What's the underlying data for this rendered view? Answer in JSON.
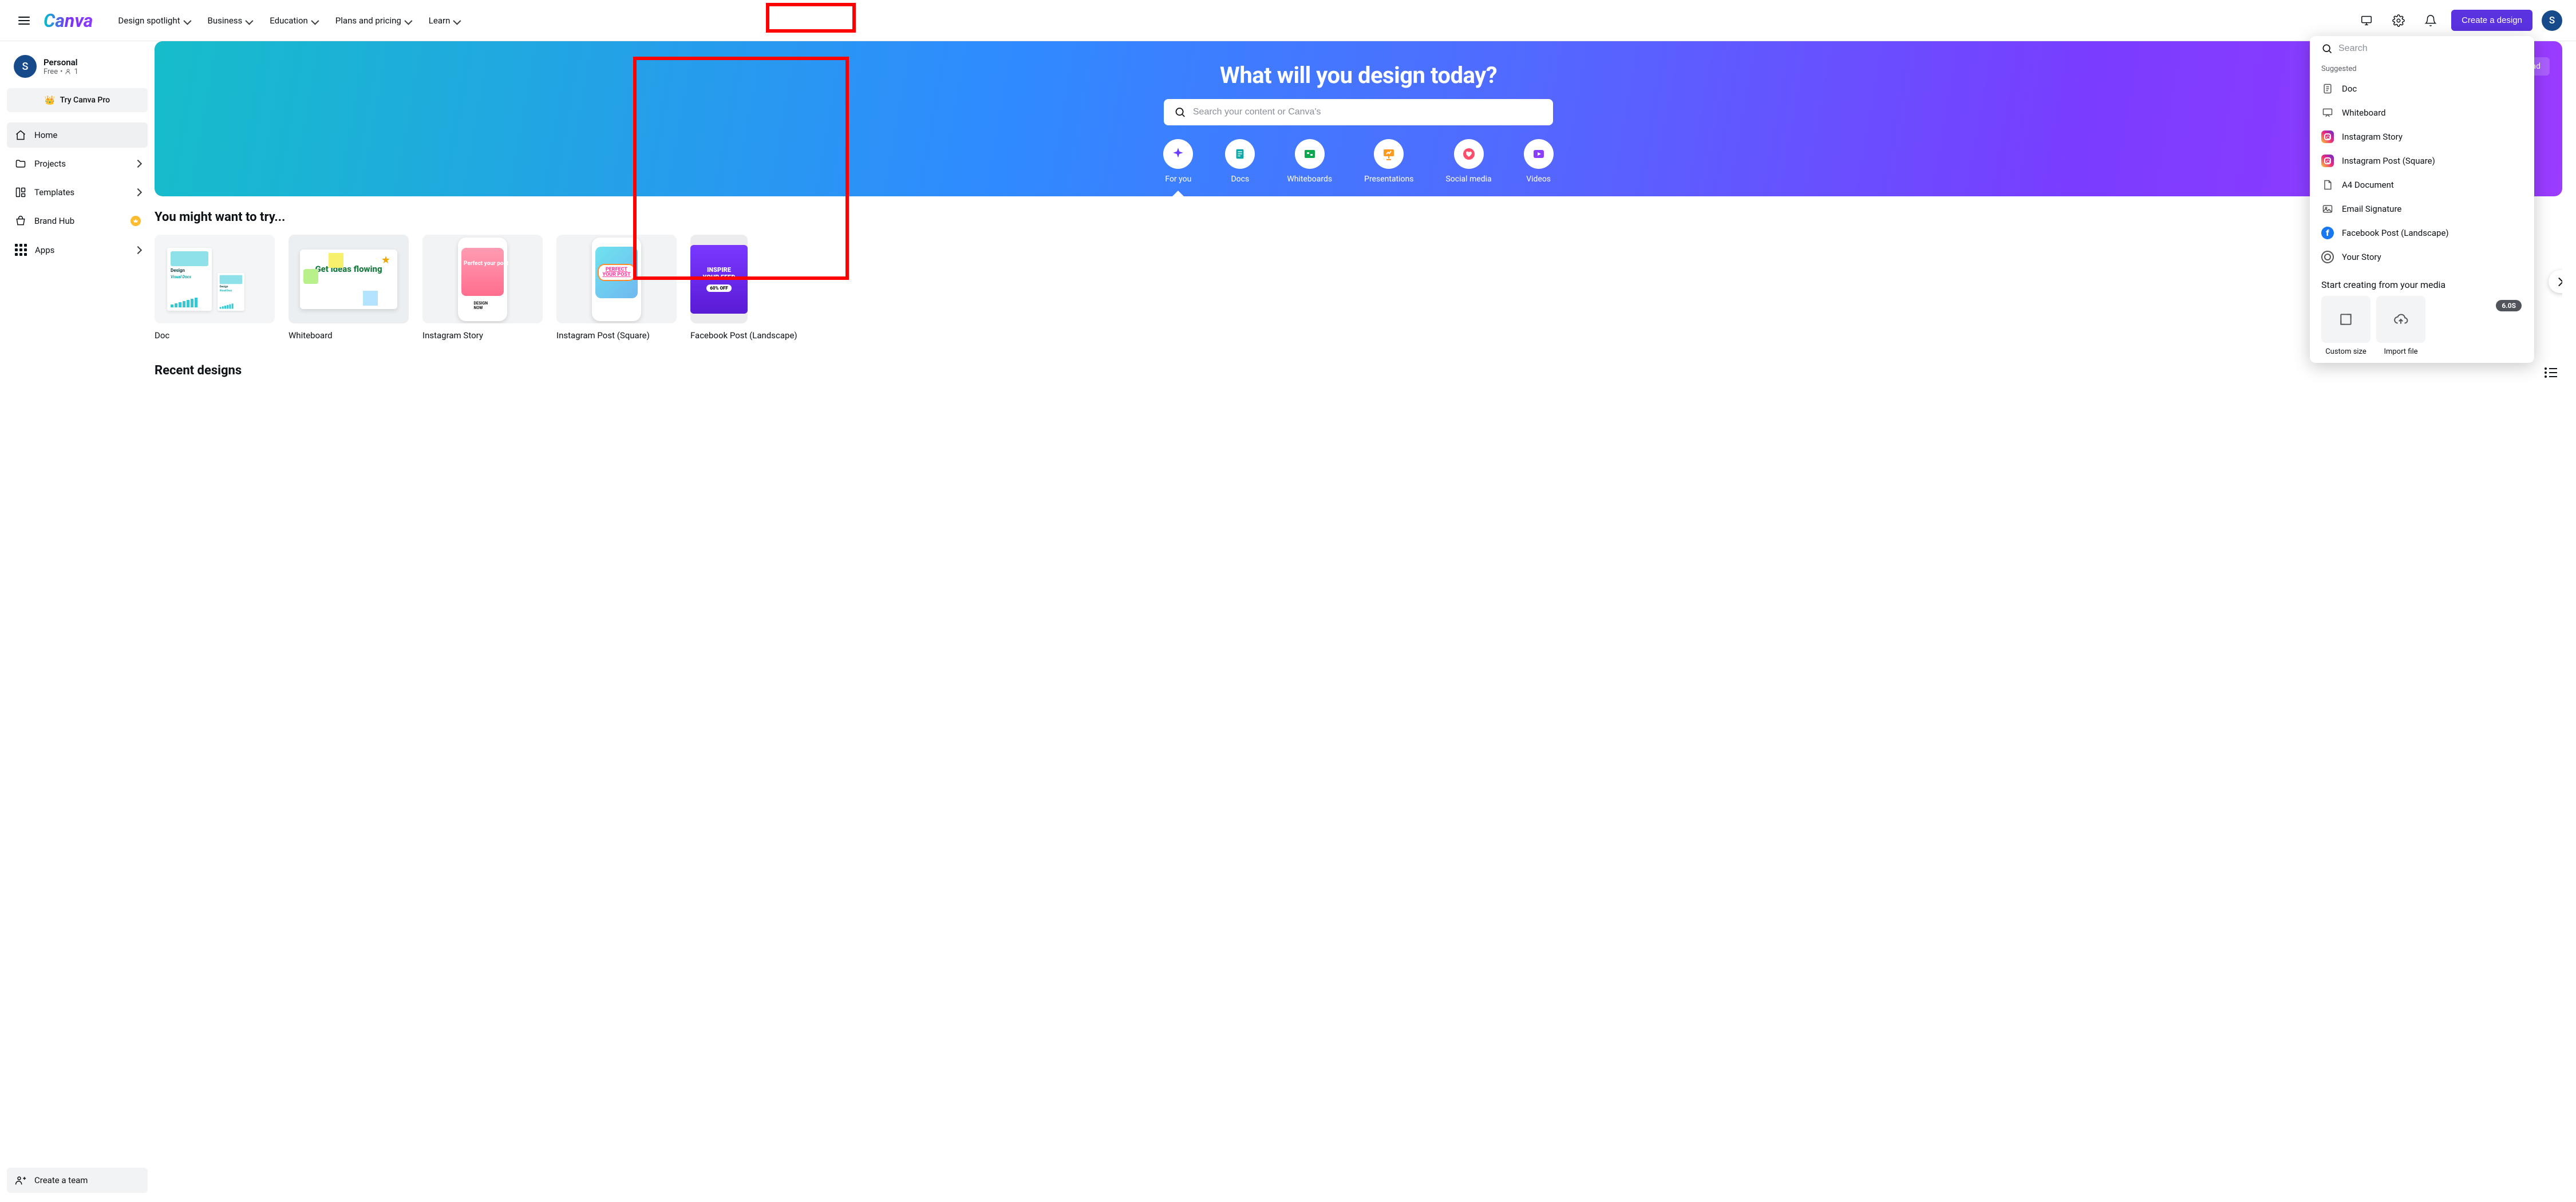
{
  "nav": {
    "links": [
      "Design spotlight",
      "Business",
      "Education",
      "Plans and pricing",
      "Learn"
    ],
    "create_label": "Create a design",
    "avatar_initial": "S"
  },
  "sidebar": {
    "user": {
      "initial": "S",
      "name": "Personal",
      "plan": "Free",
      "members": "1"
    },
    "try_pro": "Try Canva Pro",
    "items": [
      {
        "key": "home",
        "label": "Home",
        "active": true,
        "chev": false
      },
      {
        "key": "projects",
        "label": "Projects",
        "chev": true
      },
      {
        "key": "templates",
        "label": "Templates",
        "chev": true
      },
      {
        "key": "brand-hub",
        "label": "Brand Hub",
        "badge": true
      },
      {
        "key": "apps",
        "label": "Apps",
        "chev": true
      }
    ],
    "create_team": "Create a team"
  },
  "hero": {
    "title": "What will you design today?",
    "upload": "Upload",
    "search_placeholder": "Search your content or Canva's",
    "tabs": [
      {
        "key": "for-you",
        "label": "For you"
      },
      {
        "key": "docs",
        "label": "Docs"
      },
      {
        "key": "whiteboards",
        "label": "Whiteboards"
      },
      {
        "key": "presentations",
        "label": "Presentations"
      },
      {
        "key": "social-media",
        "label": "Social media"
      },
      {
        "key": "videos",
        "label": "Videos"
      }
    ]
  },
  "section_try": {
    "title": "You might want to try...",
    "cards": [
      {
        "label": "Doc"
      },
      {
        "label": "Whiteboard"
      },
      {
        "label": "Instagram Story"
      },
      {
        "label": "Instagram Post (Square)"
      },
      {
        "label": "Facebook Post (Landscape)"
      }
    ],
    "doc_thumb": {
      "title": "Design",
      "subtitle": "Visual Docs"
    },
    "wh_thumb": {
      "text": "Get ideas flowing"
    },
    "ig_thumb": {
      "text": "Perfect your post",
      "btn": "DESIGN NOW"
    },
    "ig2_thumb": {
      "line1": "PERFECT",
      "line2": "YOUR POST"
    },
    "fb_thumb": {
      "line1": "INSPIRE",
      "line2": "YOUR FEED",
      "off": "60% OFF"
    }
  },
  "recent": {
    "title": "Recent designs"
  },
  "dropdown": {
    "search_placeholder": "Search",
    "suggested_label": "Suggested",
    "items": [
      {
        "key": "doc",
        "label": "Doc"
      },
      {
        "key": "whiteboard",
        "label": "Whiteboard"
      },
      {
        "key": "instagram-story",
        "label": "Instagram Story"
      },
      {
        "key": "instagram-post",
        "label": "Instagram Post (Square)"
      },
      {
        "key": "a4",
        "label": "A4 Document"
      },
      {
        "key": "email-signature",
        "label": "Email Signature"
      },
      {
        "key": "facebook-post",
        "label": "Facebook Post (Landscape)"
      },
      {
        "key": "your-story",
        "label": "Your Story"
      }
    ],
    "media_title": "Start creating from your media",
    "tiles": [
      {
        "key": "custom-size",
        "label": "Custom size"
      },
      {
        "key": "import-file",
        "label": "Import file"
      }
    ],
    "pill": "6.0S"
  }
}
